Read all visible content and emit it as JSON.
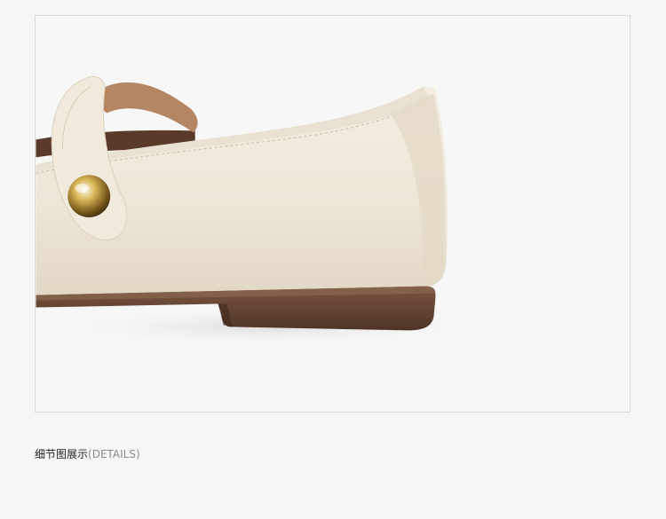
{
  "detail_section": {
    "caption_zh": "细节图展示",
    "caption_en": "(DETAILS)",
    "photo": {
      "subject": "shoe-heel-detail",
      "colors": {
        "background": "#f7f7f7",
        "leather": "#efe8da",
        "leather_shadow": "#ddd3c2",
        "lining": "#b58664",
        "sole": "#6b4a36",
        "button": "#c9a54a"
      }
    }
  }
}
